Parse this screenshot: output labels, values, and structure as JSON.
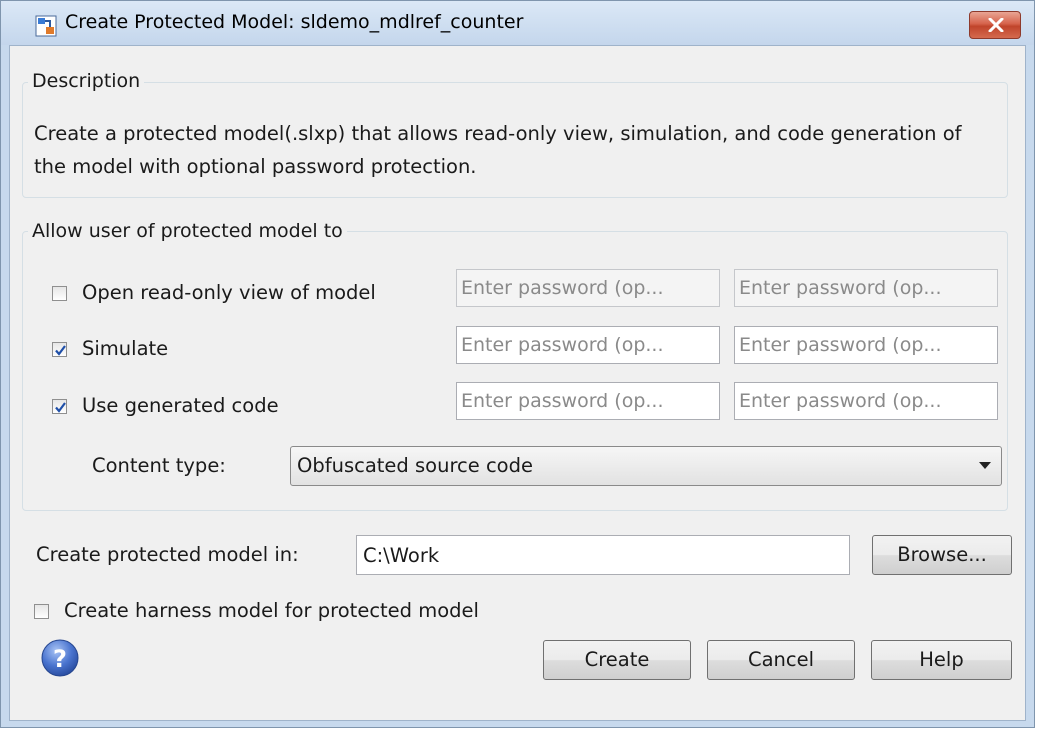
{
  "window": {
    "title": "Create Protected Model: sldemo_mdlref_counter",
    "icon": "simulink-model-icon",
    "close_icon": "close-icon"
  },
  "description": {
    "heading": "Description",
    "text": "Create a protected model(.slxp) that allows read-only view, simulation, and code generation of the model with optional password protection."
  },
  "permissions": {
    "heading": "Allow user of protected model to",
    "rows": [
      {
        "label": "Open read-only view of model",
        "checked": false,
        "password_placeholder": "Enter password (op...",
        "confirm_placeholder": "Enter password (op..."
      },
      {
        "label": "Simulate",
        "checked": true,
        "password_placeholder": "Enter password (op...",
        "confirm_placeholder": "Enter password (op..."
      },
      {
        "label": "Use generated code",
        "checked": true,
        "password_placeholder": "Enter password (op...",
        "confirm_placeholder": "Enter password (op..."
      }
    ],
    "content_type_label": "Content type:",
    "content_type_value": "Obfuscated source code"
  },
  "location": {
    "label": "Create protected model in:",
    "value": "C:\\Work",
    "browse_label": "Browse..."
  },
  "harness": {
    "label": "Create harness model for protected model",
    "checked": false
  },
  "footer": {
    "help_icon": "question-mark-icon",
    "create_label": "Create",
    "cancel_label": "Cancel",
    "help_label": "Help"
  },
  "colors": {
    "title_bar": "#c4d6ec",
    "dialog_background": "#f0f0f0",
    "close_button": "#c0442b",
    "check_mark": "#1f4fa8"
  }
}
